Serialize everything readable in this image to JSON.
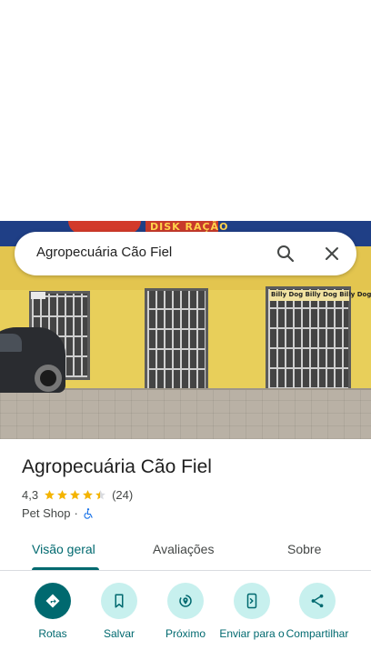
{
  "place": {
    "name": "Agropecuária Cão Fiel",
    "rating": "4,3",
    "stars_filled": 4.3,
    "review_count": "(24)",
    "category": "Pet Shop",
    "separator": "·"
  },
  "search": {
    "query": "Agropecuária Cão Fiel"
  },
  "photo": {
    "awning_text": "DISK RAÇÃO",
    "window_sign": "Billy Dog  Billy Dog  Billy Dog"
  },
  "tabs": [
    {
      "label": "Visão geral",
      "selected": true
    },
    {
      "label": "Avaliações",
      "selected": false
    },
    {
      "label": "Sobre",
      "selected": false
    }
  ],
  "actions": [
    {
      "label": "Rotas",
      "icon": "directions-icon"
    },
    {
      "label": "Salvar",
      "icon": "bookmark-icon"
    },
    {
      "label": "Próximo",
      "icon": "nearby-icon"
    },
    {
      "label": "Enviar para o",
      "icon": "send-to-phone-icon"
    },
    {
      "label": "Compartilhar",
      "icon": "share-icon"
    }
  ],
  "colors": {
    "accent": "#00696f",
    "action_bg": "#c7f0ee",
    "star": "#f4b400",
    "text_secondary": "#444746"
  }
}
